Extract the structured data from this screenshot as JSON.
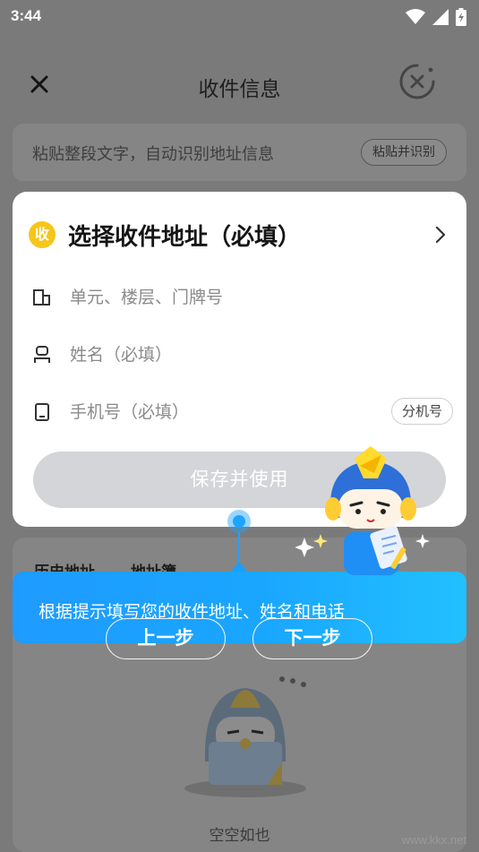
{
  "status_bar": {
    "time": "3:44",
    "icons": [
      "wifi-icon",
      "signal-icon",
      "battery-charging-icon"
    ]
  },
  "nav": {
    "title": "收件信息",
    "close_icon": "close-icon",
    "cancel_icon": "cancel-circle-icon"
  },
  "paste": {
    "placeholder": "粘贴整段文字，自动识别地址信息",
    "button": "粘贴并识别"
  },
  "form": {
    "address_badge": "收",
    "address_title": "选择收件地址（必填）",
    "fields": [
      {
        "icon": "building-icon",
        "placeholder": "单元、楼层、门牌号"
      },
      {
        "icon": "person-icon",
        "placeholder": "姓名（必填）"
      },
      {
        "icon": "phone-icon",
        "placeholder": "手机号（必填）",
        "extra_button": "分机号"
      }
    ],
    "save_button": "保存并使用"
  },
  "history": {
    "tabs": [
      "历史地址",
      "地址簿"
    ],
    "empty_text": "空空如也"
  },
  "guide": {
    "text": "根据提示填写您的收件地址、姓名和电话",
    "prev": "上一步",
    "next": "下一步"
  },
  "watermark": "www.kkx.net",
  "colors": {
    "accent_blue": "#1ca4ff",
    "badge_yellow": "#f6c61a",
    "button_disabled": "#d3d5d8",
    "overlay": "#7a7a7a"
  }
}
